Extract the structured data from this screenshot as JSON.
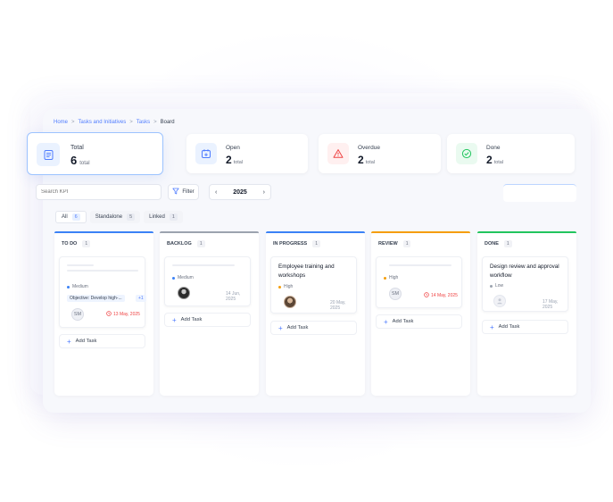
{
  "breadcrumb": [
    "Home",
    "Tasks and Initiatives",
    "Tasks",
    "Board"
  ],
  "kpis": {
    "total": {
      "label": "Total",
      "value": "6",
      "unit": "total"
    },
    "open": {
      "label": "Open",
      "value": "2",
      "unit": "total"
    },
    "overdue": {
      "label": "Overdue",
      "value": "2",
      "unit": "total"
    },
    "done": {
      "label": "Done",
      "value": "2",
      "unit": "total"
    }
  },
  "toolbar": {
    "search_placeholder": "Search KPI",
    "filter_label": "Filter",
    "year": "2025",
    "prev_icon": "chevron-left-icon",
    "next_icon": "chevron-right-icon"
  },
  "tabs": [
    {
      "label": "All",
      "count": "6"
    },
    {
      "label": "Standalone",
      "count": "5"
    },
    {
      "label": "Linked",
      "count": "1"
    }
  ],
  "columns": {
    "todo": {
      "label": "TO DO",
      "count": "1",
      "color": "#3b82f6",
      "card": {
        "priority": "Medium",
        "objective": "Objective: Develop high-...",
        "objective_more": "+1",
        "assignee": "SM",
        "date": "13 May, 2025"
      },
      "add_label": "Add Task"
    },
    "backlog": {
      "label": "BACKLOG",
      "count": "1",
      "color": "#9ca3af",
      "card": {
        "priority": "Medium",
        "date": "14 Jun, 2025"
      },
      "add_label": "Add Task"
    },
    "inprogress": {
      "label": "IN PROGRESS",
      "count": "1",
      "color": "#3b82f6",
      "card": {
        "title": "Employee training and workshops",
        "priority": "High",
        "date": "20 May, 2025"
      },
      "add_label": "Add Task"
    },
    "review": {
      "label": "REVIEW",
      "count": "1",
      "color": "#f59e0b",
      "card": {
        "priority": "High",
        "assignee": "SM",
        "date": "14 May, 2025"
      },
      "add_label": "Add Task"
    },
    "done": {
      "label": "DONE",
      "count": "1",
      "color": "#22c55e",
      "card": {
        "title": "Design review and approval workflow",
        "priority": "Low",
        "date": "17 May, 2025"
      },
      "add_label": "Add Task"
    }
  },
  "colors": {
    "accent": "#4f7cff",
    "overdue": "#ef4444",
    "medium": "#3b82f6",
    "high": "#f59e0b",
    "low": "#9ca3af"
  }
}
